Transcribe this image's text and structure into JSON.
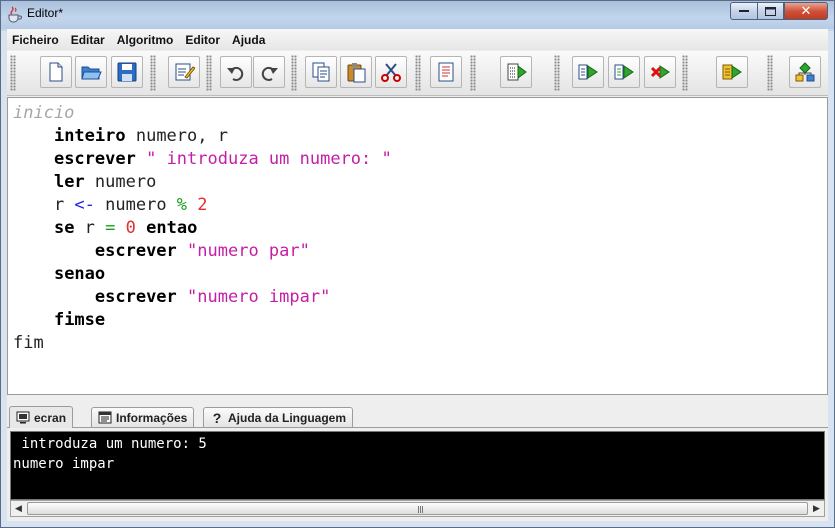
{
  "window": {
    "title": "Editor*"
  },
  "menu": [
    "Ficheiro",
    "Editar",
    "Algoritmo",
    "Editor",
    "Ajuda"
  ],
  "toolbar": {
    "buttons": [
      "new-file",
      "open-folder",
      "save",
      "edit-checklist",
      "undo",
      "redo",
      "copy",
      "paste",
      "cut",
      "document",
      "compile-binary",
      "step-run",
      "run",
      "stop",
      "run-program",
      "flowchart"
    ]
  },
  "editor": {
    "lines": [
      [
        {
          "t": "inicio",
          "c": "cm"
        }
      ],
      [
        {
          "t": "    "
        },
        {
          "t": "inteiro",
          "c": "kw"
        },
        {
          "t": " numero, r"
        }
      ],
      [
        {
          "t": "    "
        },
        {
          "t": "escrever",
          "c": "kw"
        },
        {
          "t": " "
        },
        {
          "t": "\" introduza um numero: \"",
          "c": "str"
        }
      ],
      [
        {
          "t": "    "
        },
        {
          "t": "ler",
          "c": "kw"
        },
        {
          "t": " numero"
        }
      ],
      [
        {
          "t": "    r "
        },
        {
          "t": "<-",
          "c": "op"
        },
        {
          "t": " numero "
        },
        {
          "t": "%",
          "c": "eq"
        },
        {
          "t": " "
        },
        {
          "t": "2",
          "c": "num"
        }
      ],
      [
        {
          "t": "    "
        },
        {
          "t": "se",
          "c": "kw"
        },
        {
          "t": " r "
        },
        {
          "t": "=",
          "c": "eq"
        },
        {
          "t": " "
        },
        {
          "t": "0",
          "c": "num"
        },
        {
          "t": " "
        },
        {
          "t": "entao",
          "c": "kw"
        }
      ],
      [
        {
          "t": "        "
        },
        {
          "t": "escrever",
          "c": "kw"
        },
        {
          "t": " "
        },
        {
          "t": "\"numero par\"",
          "c": "str"
        }
      ],
      [
        {
          "t": "    "
        },
        {
          "t": "senao",
          "c": "kw"
        }
      ],
      [
        {
          "t": "        "
        },
        {
          "t": "escrever",
          "c": "kw"
        },
        {
          "t": " "
        },
        {
          "t": "\"numero impar\"",
          "c": "str"
        }
      ],
      [
        {
          "t": "    "
        },
        {
          "t": "fimse",
          "c": "kw"
        }
      ],
      [
        {
          "t": "fim"
        }
      ]
    ]
  },
  "tabs": [
    {
      "label": "ecran",
      "icon": "screen-icon",
      "active": true
    },
    {
      "label": "Informações",
      "icon": "info-panel-icon",
      "active": false
    },
    {
      "label": "Ajuda da Linguagem",
      "icon": "help-icon",
      "active": false
    }
  ],
  "console": {
    "lines": [
      " introduza um numero: 5",
      "numero impar"
    ]
  },
  "colors": {
    "keyword": "#000000",
    "comment": "#a6a6a6",
    "string": "#c31fa6",
    "operator": "#1f1fe0",
    "number": "#e22f2f",
    "equals": "#1a9c1a"
  }
}
